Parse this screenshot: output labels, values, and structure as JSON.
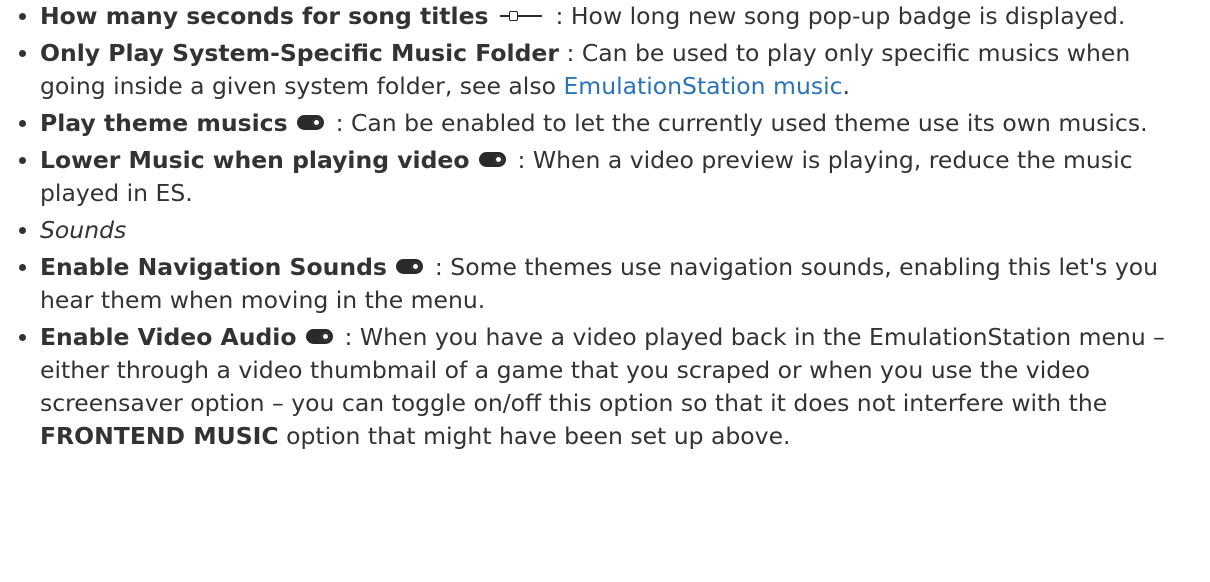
{
  "items": [
    {
      "term": "How many seconds for song titles",
      "icon": "slider-icon",
      "separator": ":",
      "description": "How long new song pop-up badge is displayed."
    },
    {
      "term": "Only Play System-Specific Music Folder",
      "separator": ":",
      "description": "Can be used to play only specific musics when going inside a given system folder, see also",
      "link_text": "EmulationStation music",
      "after_link": "."
    },
    {
      "term": "Play theme musics",
      "icon": "toggle-icon",
      "separator": ":",
      "description": "Can be enabled to let the currently used theme use its own musics."
    },
    {
      "term": "Lower Music when playing video",
      "icon": "toggle-icon",
      "separator": ":",
      "description": "When a video preview is playing, reduce the music played in ES."
    },
    {
      "heading": "Sounds"
    },
    {
      "term": "Enable Navigation Sounds",
      "icon": "toggle-icon",
      "separator": ":",
      "description": "Some themes use navigation sounds, enabling this let's you hear them when moving in the menu."
    },
    {
      "term": "Enable Video Audio",
      "icon": "toggle-icon",
      "separator": ":",
      "description": "When you have a video played back in the EmulationStation menu – either through a video thumbmail of a game that you scraped or when you use the video screensaver option – you can toggle on/off this option so that it does not interfere with the",
      "strong_text": "FRONTEND MUSIC",
      "after_strong": "option that might have been set up above."
    }
  ],
  "colors": {
    "text": "#333333",
    "link": "#2b73b7",
    "icon": "#2a2a2a"
  }
}
